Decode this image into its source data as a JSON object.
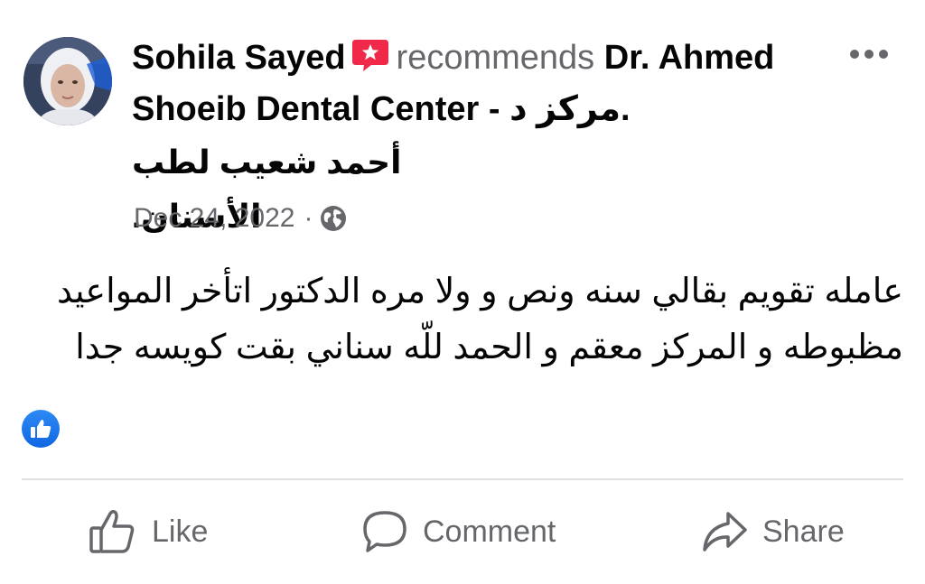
{
  "post": {
    "author": "Sohila Sayed",
    "verb": "recommends",
    "page_name": "Dr. Ahmed Shoeib Dental Center - مركز د.",
    "page_name_arabic": "أحمد شعيب لطب الأسنان.",
    "date": "Dec 24, 2022",
    "separator": "·",
    "audience_icon": "globe-icon",
    "recommend_icon": "recommend-star-icon",
    "body_line1": "عامله تقويم بقالي سنه ونص و ولا مره الدكتور اتأخر المواعيد",
    "body_line2": "مظبوطه و المركز معقم و الحمد للّه سناني بقت كويسه جدا",
    "reaction_icon": "like-reaction-icon"
  },
  "actions": {
    "like_label": "Like",
    "comment_label": "Comment",
    "share_label": "Share"
  },
  "colors": {
    "recommend_red": "#f02849",
    "reaction_blue": "#1877f2",
    "secondary_text": "#65676b"
  }
}
